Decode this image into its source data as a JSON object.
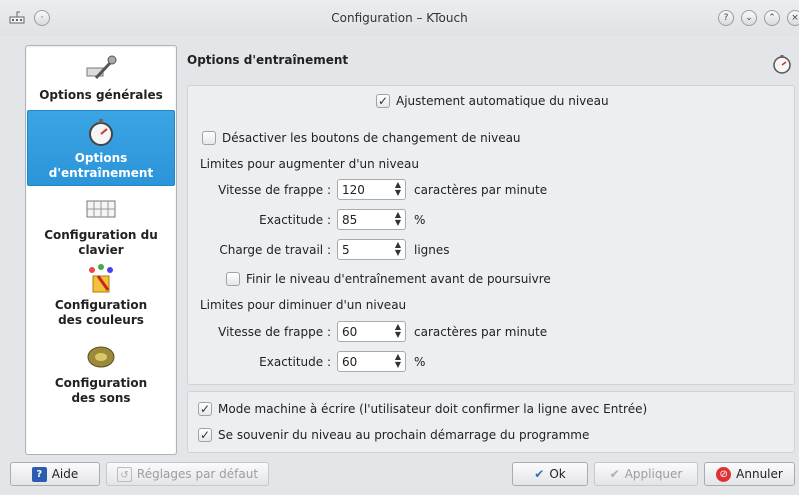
{
  "window": {
    "title": "Configuration – KTouch",
    "help_btn": "?",
    "minimize_btn": "⌄",
    "maximize_btn": "⌃",
    "close_btn": "×"
  },
  "sidebar": {
    "items": [
      {
        "label": "Options générales",
        "icon": "tools-icon",
        "selected": false
      },
      {
        "label": "Options d'entraînement",
        "icon": "stopwatch-icon",
        "selected": true
      },
      {
        "label": "Configuration du clavier",
        "icon": "keyboard-icon",
        "selected": false
      },
      {
        "label": "Configuration des couleurs",
        "icon": "paint-icon",
        "selected": false
      },
      {
        "label": "Configuration des sons",
        "icon": "speaker-icon",
        "selected": false
      }
    ]
  },
  "page": {
    "title": "Options d'entraînement"
  },
  "training": {
    "auto_level": {
      "label": "Ajustement automatique du niveau",
      "checked": true
    },
    "disable_buttons": {
      "label": "Désactiver les boutons de changement de niveau",
      "checked": false
    },
    "increase_heading": "Limites pour augmenter d'un niveau",
    "inc_speed": {
      "label": "Vitesse de frappe :",
      "value": "120",
      "suffix": "caractères par minute"
    },
    "inc_accuracy": {
      "label": "Exactitude :",
      "value": "85",
      "suffix": "%"
    },
    "inc_workload": {
      "label": "Charge de travail :",
      "value": "5",
      "suffix": "lignes"
    },
    "finish_level": {
      "label": "Finir le niveau d'entraînement avant de poursuivre",
      "checked": false
    },
    "decrease_heading": "Limites pour diminuer d'un niveau",
    "dec_speed": {
      "label": "Vitesse de frappe :",
      "value": "60",
      "suffix": "caractères par minute"
    },
    "dec_accuracy": {
      "label": "Exactitude :",
      "value": "60",
      "suffix": "%"
    }
  },
  "misc": {
    "typewriter": {
      "label": "Mode machine à écrire (l'utilisateur doit confirmer la ligne avec Entrée)",
      "checked": true
    },
    "remember": {
      "label": "Se souvenir du niveau au prochain démarrage du programme",
      "checked": true
    }
  },
  "buttons": {
    "help": "Aide",
    "defaults": "Réglages par défaut",
    "ok": "Ok",
    "apply": "Appliquer",
    "cancel": "Annuler"
  },
  "colors": {
    "accent": "#2b95d9",
    "background": "#e3e5e8",
    "panel": "#eceef0"
  }
}
